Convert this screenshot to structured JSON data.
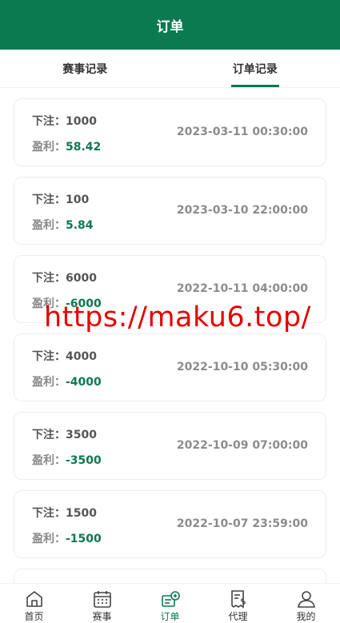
{
  "header": {
    "title": "订单"
  },
  "tabs": [
    {
      "label": "赛事记录",
      "active": false
    },
    {
      "label": "订单记录",
      "active": true
    }
  ],
  "orders": [
    {
      "bet_label": "下注：",
      "bet": "1000",
      "profit_label": "盈利：",
      "profit": "58.42",
      "time": "2023-03-11 00:30:00"
    },
    {
      "bet_label": "下注：",
      "bet": "100",
      "profit_label": "盈利：",
      "profit": "5.84",
      "time": "2023-03-10 22:00:00"
    },
    {
      "bet_label": "下注：",
      "bet": "6000",
      "profit_label": "盈利：",
      "profit": "-6000",
      "time": "2022-10-11 04:00:00"
    },
    {
      "bet_label": "下注：",
      "bet": "4000",
      "profit_label": "盈利：",
      "profit": "-4000",
      "time": "2022-10-10 05:30:00"
    },
    {
      "bet_label": "下注：",
      "bet": "3500",
      "profit_label": "盈利：",
      "profit": "-3500",
      "time": "2022-10-09 07:00:00"
    },
    {
      "bet_label": "下注：",
      "bet": "1500",
      "profit_label": "盈利：",
      "profit": "-1500",
      "time": "2022-10-07 23:59:00"
    }
  ],
  "watermark": "https://maku6.top/",
  "bottom_nav": [
    {
      "label": "首页",
      "icon": "home-icon",
      "active": false
    },
    {
      "label": "赛事",
      "icon": "calendar-icon",
      "active": false
    },
    {
      "label": "订单",
      "icon": "order-icon",
      "active": true
    },
    {
      "label": "代理",
      "icon": "agent-icon",
      "active": false
    },
    {
      "label": "我的",
      "icon": "user-icon",
      "active": false
    }
  ],
  "colors": {
    "brand": "#0b7a50",
    "watermark": "#e60000"
  }
}
